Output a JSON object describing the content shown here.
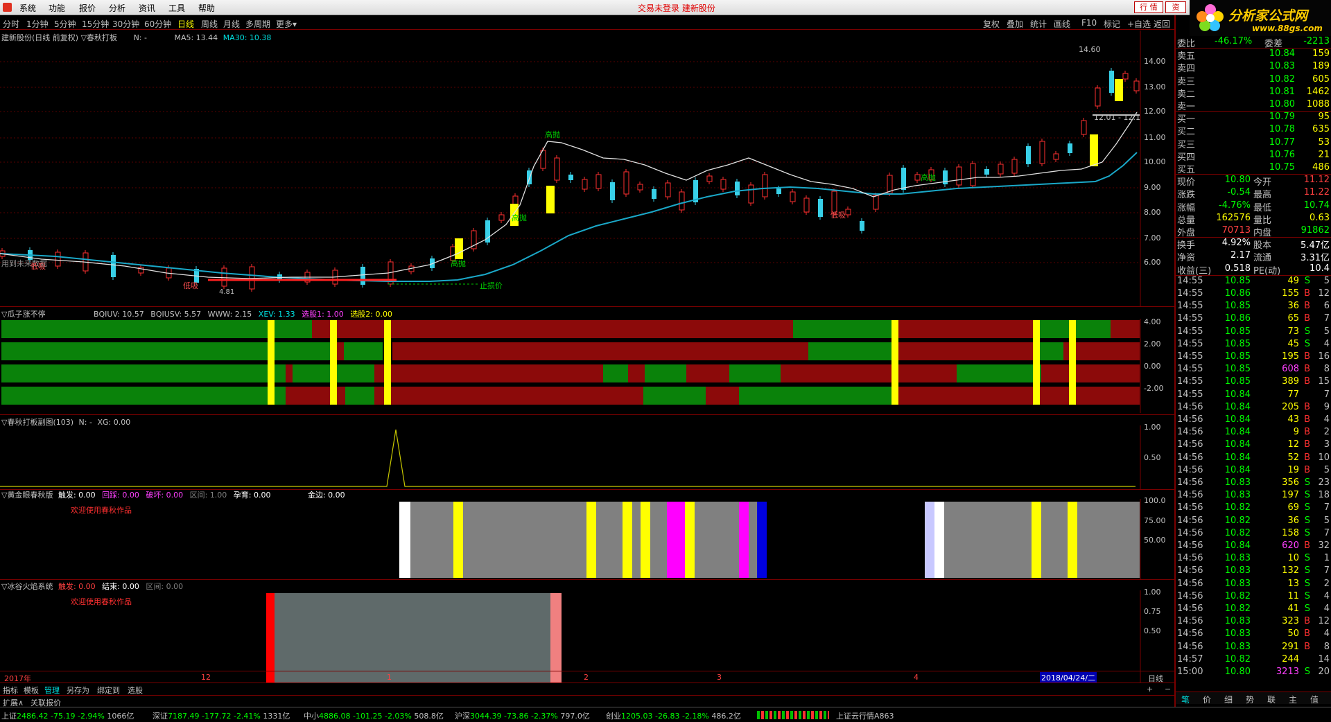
{
  "menu": {
    "items": [
      "系统",
      "功能",
      "报价",
      "分析",
      "资讯",
      "工具",
      "帮助"
    ],
    "center_text": "交易未登录  建新股份",
    "right_buttons": [
      "行 情",
      "资"
    ]
  },
  "logo": {
    "title": "分析家公式网",
    "url_text": "www.88gs.com"
  },
  "periods": {
    "items": [
      "分时",
      "1分钟",
      "5分钟",
      "15分钟",
      "30分钟",
      "60分钟",
      "日线",
      "周线",
      "月线",
      "多周期",
      "更多▾"
    ],
    "active": "日线",
    "right_items": [
      "复权",
      "叠加",
      "统计",
      "画线",
      "F10",
      "标记",
      "+自选",
      "返回"
    ]
  },
  "main": {
    "title": "建新股份(日线 前复权)",
    "indicator": "▽春秋打板",
    "n_label": "N: -",
    "ma5": "MA5: 13.44",
    "ma30": "MA30: 10.38",
    "note": "用到未来数据",
    "high_label": "14.60",
    "level_label": "12.01 - 12.1",
    "low_label": "4.81",
    "stop_label": "止损价",
    "annot_high": "高抛",
    "annot_low": "低吸",
    "y_labels": [
      "14.00",
      "13.00",
      "12.00",
      "11.00",
      "10.00",
      "9.00",
      "8.00",
      "7.00",
      "6.00"
    ]
  },
  "p1": {
    "title": "▽瓜子涨不停",
    "values": [
      {
        "text": "BQIUV: 10.57",
        "color": "#c0c0c0"
      },
      {
        "text": "BQIUSV: 5.57",
        "color": "#c0c0c0"
      },
      {
        "text": "WWW: 2.15",
        "color": "#c0c0c0"
      },
      {
        "text": "XEV: 1.33",
        "color": "#00e0e0"
      },
      {
        "text": "选股1: 1.00",
        "color": "#ff40ff"
      },
      {
        "text": "选股2: 0.00",
        "color": "#ffff00"
      }
    ],
    "y_labels": [
      "4.00",
      "2.00",
      "0.00",
      "-2.00"
    ]
  },
  "p2": {
    "title": "▽春秋打板副图(103)",
    "n_label": "N: -",
    "xg": "XG: 0.00",
    "y_labels": [
      "1.00",
      "0.50"
    ]
  },
  "p3": {
    "title": "▽黄金眼春秋版",
    "values": [
      {
        "text": "触发: 0.00",
        "color": "#ffffff"
      },
      {
        "text": "回踩: 0.00",
        "color": "#ff40ff"
      },
      {
        "text": "破坏: 0.00",
        "color": "#ff40ff"
      },
      {
        "text": "区间: 1.00",
        "color": "#808080"
      },
      {
        "text": "孕育: 0.00",
        "color": "#ffffff"
      },
      {
        "text": "金边: 0.00",
        "color": "#ffffff"
      }
    ],
    "welcome": "欢迎使用春秋作品",
    "y_labels": [
      "100.0",
      "75.00",
      "50.00"
    ]
  },
  "p4": {
    "title": "▽冰谷火焰系统",
    "values": [
      {
        "text": "触发: 0.00",
        "color": "#ff4040"
      },
      {
        "text": "结束: 0.00",
        "color": "#ffffff"
      },
      {
        "text": "区间: 0.00",
        "color": "#808080"
      }
    ],
    "welcome": "欢迎使用春秋作品",
    "y_labels": [
      "1.00",
      "0.75",
      "0.50"
    ]
  },
  "xaxis": {
    "labels": [
      "2017年",
      "12",
      "1",
      "2",
      "3",
      "4"
    ],
    "date_box": "2018/04/24/二",
    "right_label": "日线"
  },
  "bottom_tabs": {
    "row1": [
      "指标",
      "模板",
      "管理",
      "另存为",
      "绑定到",
      "选股"
    ],
    "row2": [
      "扩展∧",
      "关联报价"
    ]
  },
  "quote": {
    "weibi": {
      "label": "委比",
      "value": "-46.17%",
      "label2": "委差",
      "value2": "-2213"
    },
    "asks": [
      {
        "label": "卖五",
        "price": "10.84",
        "vol": "159"
      },
      {
        "label": "卖四",
        "price": "10.83",
        "vol": "189"
      },
      {
        "label": "卖三",
        "price": "10.82",
        "vol": "605"
      },
      {
        "label": "卖二",
        "price": "10.81",
        "vol": "1462"
      },
      {
        "label": "卖一",
        "price": "10.80",
        "vol": "1088"
      }
    ],
    "bids": [
      {
        "label": "买一",
        "price": "10.79",
        "vol": "95"
      },
      {
        "label": "买二",
        "price": "10.78",
        "vol": "635"
      },
      {
        "label": "买三",
        "price": "10.77",
        "vol": "53"
      },
      {
        "label": "买四",
        "price": "10.76",
        "vol": "21"
      },
      {
        "label": "买五",
        "price": "10.75",
        "vol": "486"
      }
    ],
    "stats": [
      {
        "k1": "现价",
        "v1": "10.80",
        "c1": "#00ff00",
        "k2": "今开",
        "v2": "11.12",
        "c2": "#ff4040"
      },
      {
        "k1": "涨跌",
        "v1": "-0.54",
        "c1": "#00ff00",
        "k2": "最高",
        "v2": "11.22",
        "c2": "#ff4040"
      },
      {
        "k1": "涨幅",
        "v1": "-4.76%",
        "c1": "#00ff00",
        "k2": "最低",
        "v2": "10.74",
        "c2": "#00ff00"
      },
      {
        "k1": "总量",
        "v1": "162576",
        "c1": "#ffff00",
        "k2": "量比",
        "v2": "0.63",
        "c2": "#ffff00"
      },
      {
        "k1": "外盘",
        "v1": "70713",
        "c1": "#ff4040",
        "k2": "内盘",
        "v2": "91862",
        "c2": "#00ff00"
      }
    ],
    "stats2": [
      {
        "k1": "换手",
        "v1": "4.92%",
        "k2": "股本",
        "v2": "5.47亿"
      },
      {
        "k1": "净资",
        "v1": "2.17",
        "k2": "流通",
        "v2": "3.31亿"
      },
      {
        "k1": "收益(三)",
        "v1": "0.518",
        "k2": "PE(动)",
        "v2": "10.4"
      }
    ],
    "ticks": [
      [
        "14:55",
        "10.85",
        "49",
        "S",
        "5"
      ],
      [
        "14:55",
        "10.86",
        "155",
        "B",
        "12"
      ],
      [
        "14:55",
        "10.85",
        "36",
        "B",
        "6"
      ],
      [
        "14:55",
        "10.86",
        "65",
        "B",
        "7"
      ],
      [
        "14:55",
        "10.85",
        "73",
        "S",
        "5"
      ],
      [
        "14:55",
        "10.85",
        "45",
        "S",
        "4"
      ],
      [
        "14:55",
        "10.85",
        "195",
        "B",
        "16"
      ],
      [
        "14:55",
        "10.85",
        "608",
        "B",
        "8"
      ],
      [
        "14:55",
        "10.85",
        "389",
        "B",
        "15"
      ],
      [
        "14:55",
        "10.84",
        "77",
        "",
        "7"
      ],
      [
        "14:56",
        "10.84",
        "205",
        "B",
        "9"
      ],
      [
        "14:56",
        "10.84",
        "43",
        "B",
        "4"
      ],
      [
        "14:56",
        "10.84",
        "9",
        "B",
        "2"
      ],
      [
        "14:56",
        "10.84",
        "12",
        "B",
        "3"
      ],
      [
        "14:56",
        "10.84",
        "52",
        "B",
        "10"
      ],
      [
        "14:56",
        "10.84",
        "19",
        "B",
        "5"
      ],
      [
        "14:56",
        "10.83",
        "356",
        "S",
        "23"
      ],
      [
        "14:56",
        "10.83",
        "197",
        "S",
        "18"
      ],
      [
        "14:56",
        "10.82",
        "69",
        "S",
        "7"
      ],
      [
        "14:56",
        "10.82",
        "36",
        "S",
        "5"
      ],
      [
        "14:56",
        "10.82",
        "158",
        "S",
        "7"
      ],
      [
        "14:56",
        "10.84",
        "620",
        "B",
        "32"
      ],
      [
        "14:56",
        "10.83",
        "10",
        "S",
        "1"
      ],
      [
        "14:56",
        "10.83",
        "132",
        "S",
        "7"
      ],
      [
        "14:56",
        "10.83",
        "13",
        "S",
        "2"
      ],
      [
        "14:56",
        "10.82",
        "11",
        "S",
        "4"
      ],
      [
        "14:56",
        "10.82",
        "41",
        "S",
        "4"
      ],
      [
        "14:56",
        "10.83",
        "323",
        "B",
        "12"
      ],
      [
        "14:56",
        "10.83",
        "50",
        "B",
        "4"
      ],
      [
        "14:56",
        "10.83",
        "291",
        "B",
        "8"
      ],
      [
        "14:57",
        "10.82",
        "244",
        "",
        "14"
      ],
      [
        "15:00",
        "10.80",
        "3213",
        "S",
        "20"
      ]
    ],
    "tabs": [
      "笔",
      "价",
      "细",
      "势",
      "联",
      "主",
      "值"
    ]
  },
  "status": [
    {
      "name": "上证",
      "val": "2486.42",
      "chg": "-75.19",
      "pct": "-2.94%",
      "amt": "1066亿"
    },
    {
      "name": "深证",
      "val": "7187.49",
      "chg": "-177.72",
      "pct": "-2.41%",
      "amt": "1331亿"
    },
    {
      "name": "中小",
      "val": "4886.08",
      "chg": "-101.25",
      "pct": "-2.03%",
      "amt": "508.8亿"
    },
    {
      "name": "沪深",
      "val": "3044.39",
      "chg": "-73.86",
      "pct": "-2.37%",
      "amt": "797.0亿"
    },
    {
      "name": "创业",
      "val": "1205.03",
      "chg": "-26.83",
      "pct": "-2.18%",
      "amt": "486.2亿"
    }
  ],
  "status_right": "上证云行情A863"
}
